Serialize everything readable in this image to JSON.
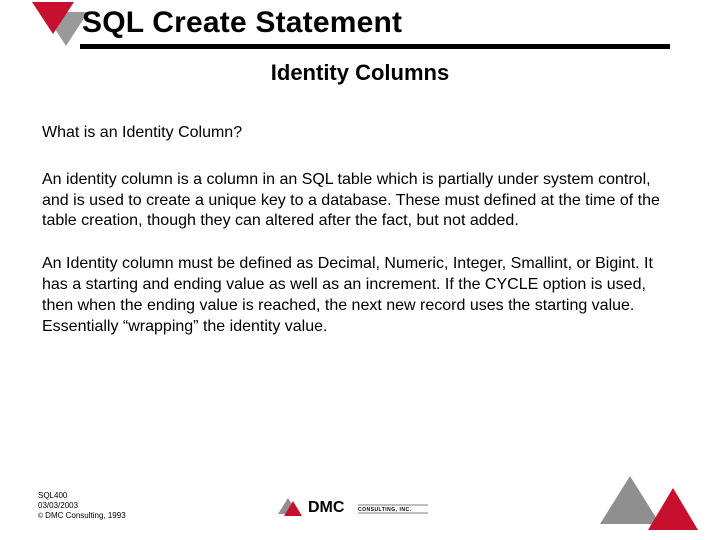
{
  "header": {
    "title": "SQL Create Statement",
    "subtitle": "Identity Columns"
  },
  "body": {
    "question": "What is an Identity Column?",
    "para1": "An identity column is a column in an SQL table which is partially under system control, and is used to create a unique key to a database.  These must defined at the time of the table creation, though they can altered after the fact, but not added.",
    "para2": "An Identity column must be defined as Decimal, Numeric, Integer, Smallint, or Bigint.  It has a starting and ending value as well as an increment.  If the CYCLE option is used, then when the ending value is reached, the next new record uses the starting value.  Essentially “wrapping” the identity value."
  },
  "footer": {
    "code": "SQL400",
    "date": "03/03/2003",
    "copyright": "DMC Consulting, 1993",
    "logo_text": "DMC",
    "logo_sub": "CONSULTING, INC."
  }
}
